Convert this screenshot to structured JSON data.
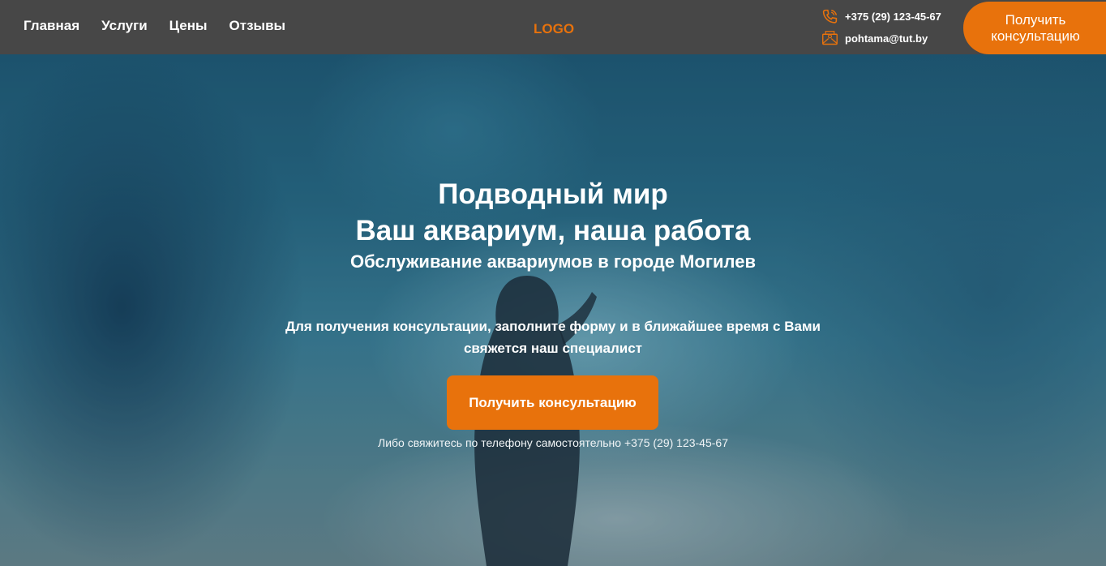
{
  "header": {
    "nav": [
      "Главная",
      "Услуги",
      "Цены",
      "Отзывы"
    ],
    "logo": "LOGO",
    "phone": "+375 (29) 123-45-67",
    "email": "pohtama@tut.by",
    "cta_label": "Получить консультацию"
  },
  "hero": {
    "title_line1": "Подводный мир",
    "title_line2": "Ваш аквариум, наша работа",
    "subtitle": "Обслуживание аквариумов в городе Могилев",
    "description": "Для получения консультации, заполните форму и в ближайшее время с Вами свяжется наш специалист",
    "cta_label": "Получить консультацию",
    "phone_note": "Либо свяжитесь по телефону самостоятельно +375 (29) 123-45-67"
  },
  "colors": {
    "accent": "#e8720c",
    "header_bg": "#474747",
    "text": "#ffffff"
  },
  "icons": {
    "phone": "phone-icon",
    "email": "envelope-icon"
  }
}
